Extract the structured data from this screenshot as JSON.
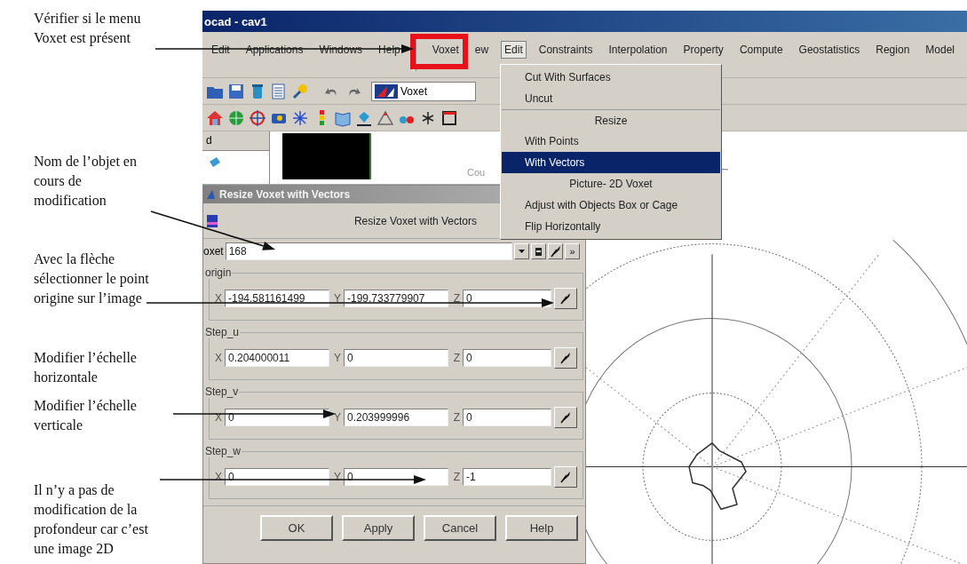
{
  "annotations": [
    "Vérifier si le menu\nVoxet est présent",
    "Nom de l’objet en\ncours de\nmodification",
    "Avec la flèche\nsélectionner le point\norigine sur l’image",
    "Modifier l’échelle\nhorizontale",
    "Modifier l’échelle\nverticale",
    "Il n’y a pas de\nmodification de la\nprofondeur car  c’est\nune image 2D"
  ],
  "window": {
    "title": "ocad - cav1"
  },
  "app_menus": [
    {
      "label": "Edit",
      "selected": false
    },
    {
      "label": "Applications",
      "selected": false
    },
    {
      "label": "Windows",
      "selected": false
    },
    {
      "label": "Help",
      "selected": false
    }
  ],
  "module_menus": [
    {
      "label": "Voxet",
      "selected": false
    },
    {
      "label": "ew",
      "selected": false
    },
    {
      "label": "Edit",
      "selected": true
    },
    {
      "label": "Constraints",
      "selected": false
    },
    {
      "label": "Interpolation",
      "selected": false
    },
    {
      "label": "Property",
      "selected": false
    },
    {
      "label": "Compute",
      "selected": false
    },
    {
      "label": "Geostatistics",
      "selected": false
    },
    {
      "label": "Region",
      "selected": false
    },
    {
      "label": "Model",
      "selected": false
    }
  ],
  "object_combo": {
    "value": "Voxet"
  },
  "panel": {
    "tree_header": "d",
    "caption": "Cou"
  },
  "edit_menu": [
    {
      "kind": "item",
      "label": "Cut With Surfaces",
      "selected": false
    },
    {
      "kind": "item",
      "label": "Uncut",
      "selected": false
    },
    {
      "kind": "header",
      "label": "Resize",
      "selected": false
    },
    {
      "kind": "item",
      "label": "With Points",
      "selected": false
    },
    {
      "kind": "item",
      "label": "With Vectors",
      "selected": true
    },
    {
      "kind": "header",
      "label": "Picture- 2D Voxet",
      "selected": false
    },
    {
      "kind": "item",
      "label": "Adjust with Objects Box or Cage",
      "selected": false
    },
    {
      "kind": "item",
      "label": "Flip Horizontally",
      "selected": false
    }
  ],
  "dialog": {
    "title": "Resize Voxet with Vectors",
    "heading": "Resize Voxet with Vectors",
    "object_label": "oxet",
    "object_value": "168",
    "more_button": "»",
    "groups": [
      {
        "label": "origin",
        "fields": [
          {
            "axis": "X",
            "value": "-194.581161499"
          },
          {
            "axis": "Y",
            "value": "-199.733779907"
          },
          {
            "axis": "Z",
            "value": "0"
          }
        ]
      },
      {
        "label": "Step_u",
        "fields": [
          {
            "axis": "X",
            "value": "0.204000011"
          },
          {
            "axis": "Y",
            "value": "0"
          },
          {
            "axis": "Z",
            "value": "0"
          }
        ]
      },
      {
        "label": "Step_v",
        "fields": [
          {
            "axis": "X",
            "value": "0"
          },
          {
            "axis": "Y",
            "value": "0.203999996"
          },
          {
            "axis": "Z",
            "value": "0"
          }
        ]
      },
      {
        "label": "Step_w",
        "fields": [
          {
            "axis": "X",
            "value": "0"
          },
          {
            "axis": "Y",
            "value": "0"
          },
          {
            "axis": "Z",
            "value": "-1"
          }
        ]
      }
    ],
    "buttons": [
      "OK",
      "Apply",
      "Cancel",
      "Help"
    ]
  }
}
